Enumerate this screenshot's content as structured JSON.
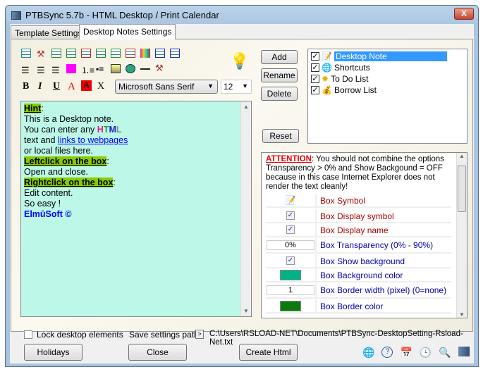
{
  "window": {
    "title": "PTBSync 5.7b - HTML Desktop / Print Calendar",
    "close": "X"
  },
  "tabs": [
    {
      "label": "Template Settings"
    },
    {
      "label": "Desktop Notes Settings"
    }
  ],
  "toolbar": {
    "font": "Microsoft Sans Serif",
    "size": "12",
    "bold": "B",
    "italic": "I",
    "underline": "U",
    "font_color": "A",
    "back_color": "A",
    "clear": "X",
    "colors": {
      "magenta": "#ff00ff",
      "highlight": "#8acb00"
    }
  },
  "editor": {
    "hint": "Hint",
    "line1": "This is a Desktop note.",
    "line2a": "You can enter any ",
    "html_h": "H",
    "html_t": "T",
    "html_m": "M",
    "html_l": "L",
    "line3a": "text and ",
    "link": "links to webpages",
    "line4": "or local files here.",
    "left": "Leftclick on the box",
    "line5": "Open and close.",
    "right": "Rightclick on the box",
    "line6": "Edit content.",
    "line7": "So easy !",
    "brand": "ElmūSoft ©",
    "colon": ":",
    "bg": "#bcf7e7"
  },
  "buttons": {
    "add": "Add",
    "rename": "Rename",
    "delete": "Delete",
    "reset": "Reset",
    "holidays": "Holidays",
    "close": "Close",
    "create_html": "Create Html"
  },
  "tree": [
    {
      "label": "Desktop Note",
      "checked": true,
      "selected": true
    },
    {
      "label": "Shortcuts",
      "checked": true
    },
    {
      "label": "To Do List",
      "checked": true
    },
    {
      "label": "Borrow List",
      "checked": true
    }
  ],
  "props": {
    "attention": "ATTENTION",
    "warning": ": You should not combine the options Transparency > 0% and Show Backgound = OFF because in this case Internet Explorer does not render the text cleanly!",
    "rows": [
      {
        "label": "Box Symbol"
      },
      {
        "label": "Box Display symbol",
        "value": "✓"
      },
      {
        "label": "Box Display name",
        "value": "✓"
      },
      {
        "label": "Box Transparency (0% - 90%)",
        "value": "0%"
      },
      {
        "label": "Box Show background",
        "value": "✓"
      },
      {
        "label": "Box Background color",
        "color": "#00b386"
      },
      {
        "label": "Box Border width (pixel) (0=none)",
        "value": "1"
      },
      {
        "label": "Box Border color",
        "color": "#0a7a0a"
      }
    ]
  },
  "footer": {
    "lock": "Lock desktop elements",
    "save_label": "Save settings path",
    "arrow": ">",
    "path": "C:\\Users\\RSLOAD-NET\\Documents\\PTBSync-DesktopSetting-Rsload-Net.txt"
  }
}
